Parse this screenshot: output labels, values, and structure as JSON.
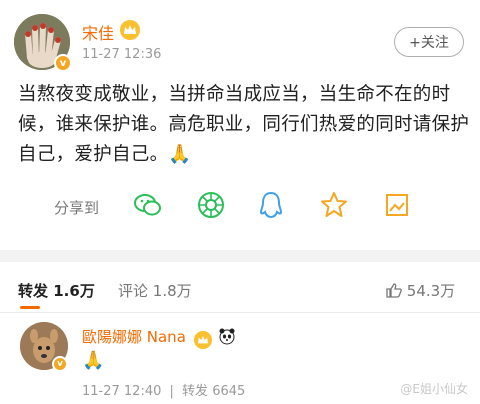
{
  "post": {
    "username": "宋佳",
    "time": "11-27 12:36",
    "follow_label": "+关注",
    "text": "当熬夜变成敬业，当拼命当成应当，当生命不在的时候，谁来保护谁。高危职业，同行们热爱的同时请保护自己，爱护自己。🙏"
  },
  "share": {
    "label": "分享到",
    "icons": [
      "wechat-icon",
      "moments-icon",
      "qq-icon",
      "qzone-star-icon",
      "photo-icon"
    ]
  },
  "tabs": {
    "repost_label": "转发",
    "repost_count": "1.6万",
    "comment_label": "评论",
    "comment_count": "1.8万",
    "like_count": "54.3万"
  },
  "comment": {
    "username": "歐陽娜娜 Nana",
    "text": "🙏",
    "time": "11-27 12:40",
    "repost_label": "转发",
    "repost_count": "6645"
  },
  "watermark": "@E姐小仙女",
  "colors": {
    "accent": "#f56a00",
    "gold": "#f5a623",
    "divider": "#f2f2f2"
  }
}
